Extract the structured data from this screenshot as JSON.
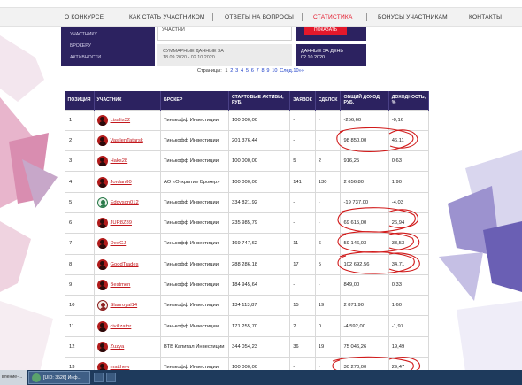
{
  "nav": {
    "items": [
      {
        "label": "О КОНКУРСЕ",
        "active": false
      },
      {
        "label": "КАК СТАТЬ УЧАСТНИКОМ",
        "active": false
      },
      {
        "label": "ОТВЕТЫ НА ВОПРОСЫ",
        "active": false
      },
      {
        "label": "СТАТИСТИКА",
        "active": true
      },
      {
        "label": "БОНУСЫ УЧАСТНИКАМ",
        "active": false
      },
      {
        "label": "КОНТАКТЫ",
        "active": false
      }
    ]
  },
  "sidebar": {
    "items": [
      "УЧАСТНИКУ",
      "БРОКЕРУ",
      "АКТИВНОСТИ"
    ]
  },
  "filters": {
    "top_label": "УЧАСТНИ",
    "show_button": "ПОКАЗАТЬ",
    "summary_line1": "СУММАРНЫЕ ДАННЫЕ ЗА",
    "summary_line2": "18.09.2020 - 02.10.2020",
    "day_line1": "ДАННЫЕ ЗА ДЕНЬ",
    "day_line2": "02.10.2020"
  },
  "pagination": {
    "label": "Страницы:",
    "current": "1",
    "pages": [
      "2",
      "3",
      "4",
      "5",
      "6",
      "7",
      "8",
      "9",
      "10"
    ],
    "next": "След.10»»"
  },
  "table": {
    "headers": [
      "ПОЗИЦИЯ",
      "УЧАСТНИК",
      "БРОКЕР",
      "СТАРТОВЫЕ АКТИВЫ, РУБ.",
      "ЗАЯВОК",
      "СДЕЛОК",
      "ОБЩИЙ ДОХОД, РУБ.",
      "ДОХОДНОСТЬ, %"
    ],
    "rows": [
      {
        "pos": "1",
        "user": "Lisalis32",
        "broker": "Тинькофф Инвестиции",
        "assets": "100 000,00",
        "orders": "-",
        "deals": "-",
        "income": "-256,60",
        "yield": "-0,16",
        "avatar": "red"
      },
      {
        "pos": "2",
        "user": "VasilenTatarsk",
        "broker": "Тинькофф Инвестиции",
        "assets": "201 376,44",
        "orders": "-",
        "deals": "-",
        "income": "98 850,00",
        "yield": "46,11",
        "avatar": "red"
      },
      {
        "pos": "3",
        "user": "Haks28",
        "broker": "Тинькофф Инвестиции",
        "assets": "100 000,00",
        "orders": "5",
        "deals": "2",
        "income": "916,25",
        "yield": "0,63",
        "avatar": "red"
      },
      {
        "pos": "4",
        "user": "Jordan80",
        "broker": "АО «Открытие Брокер»",
        "assets": "100 000,00",
        "orders": "141",
        "deals": "130",
        "income": "2 656,80",
        "yield": "1,90",
        "avatar": "red"
      },
      {
        "pos": "5",
        "user": "Eddyson012",
        "broker": "Тинькофф Инвестиции",
        "assets": "334 821,92",
        "orders": "-",
        "deals": "-",
        "income": "-19 737,00",
        "yield": "-4,03",
        "avatar": "green"
      },
      {
        "pos": "6",
        "user": "JUR8Z89",
        "broker": "Тинькофф Инвестиции",
        "assets": "235 985,79",
        "orders": "-",
        "deals": "-",
        "income": "69 615,00",
        "yield": "26,94",
        "avatar": "red"
      },
      {
        "pos": "7",
        "user": "DeeCJ",
        "broker": "Тинькофф Инвестиции",
        "assets": "169 747,62",
        "orders": "11",
        "deals": "6",
        "income": "59 146,03",
        "yield": "33,53",
        "avatar": "red"
      },
      {
        "pos": "8",
        "user": "GoodTrades",
        "broker": "Тинькофф Инвестиции",
        "assets": "288 286,18",
        "orders": "17",
        "deals": "5",
        "income": "102 692,56",
        "yield": "34,71",
        "avatar": "red"
      },
      {
        "pos": "9",
        "user": "Bestmen",
        "broker": "Тинькофф Инвестиции",
        "assets": "184 945,64",
        "orders": "-",
        "deals": "-",
        "income": "849,00",
        "yield": "0,33",
        "avatar": "red"
      },
      {
        "pos": "10",
        "user": "Slanroyal14",
        "broker": "Тинькофф Инвестиции",
        "assets": "134 113,87",
        "orders": "15",
        "deals": "19",
        "income": "2 871,90",
        "yield": "1,60",
        "avatar": "dark"
      },
      {
        "pos": "11",
        "user": "civilizator",
        "broker": "Тинькофф Инвестиции",
        "assets": "171 255,70",
        "orders": "2",
        "deals": "0",
        "income": "-4 592,00",
        "yield": "-1,97",
        "avatar": "red"
      },
      {
        "pos": "12",
        "user": "Zuzya",
        "broker": "ВТБ Капитал Инвестиции",
        "assets": "344 054,23",
        "orders": "36",
        "deals": "19",
        "income": "75 046,26",
        "yield": "19,49",
        "avatar": "red"
      },
      {
        "pos": "13",
        "user": "matthew",
        "broker": "Тинькофф Инвестиции",
        "assets": "100 000,00",
        "orders": "-",
        "deals": "-",
        "income": "30 270,00",
        "yield": "29,47",
        "avatar": "red"
      }
    ]
  },
  "taskbar": {
    "left_label": "вление-...",
    "app_label": "[UID: 3526] Инф..."
  },
  "colors": {
    "accent_red": "#e4182b",
    "panel_navy": "#2c2260",
    "link_red": "#c2171c",
    "annotation_red": "#d11a1a"
  }
}
